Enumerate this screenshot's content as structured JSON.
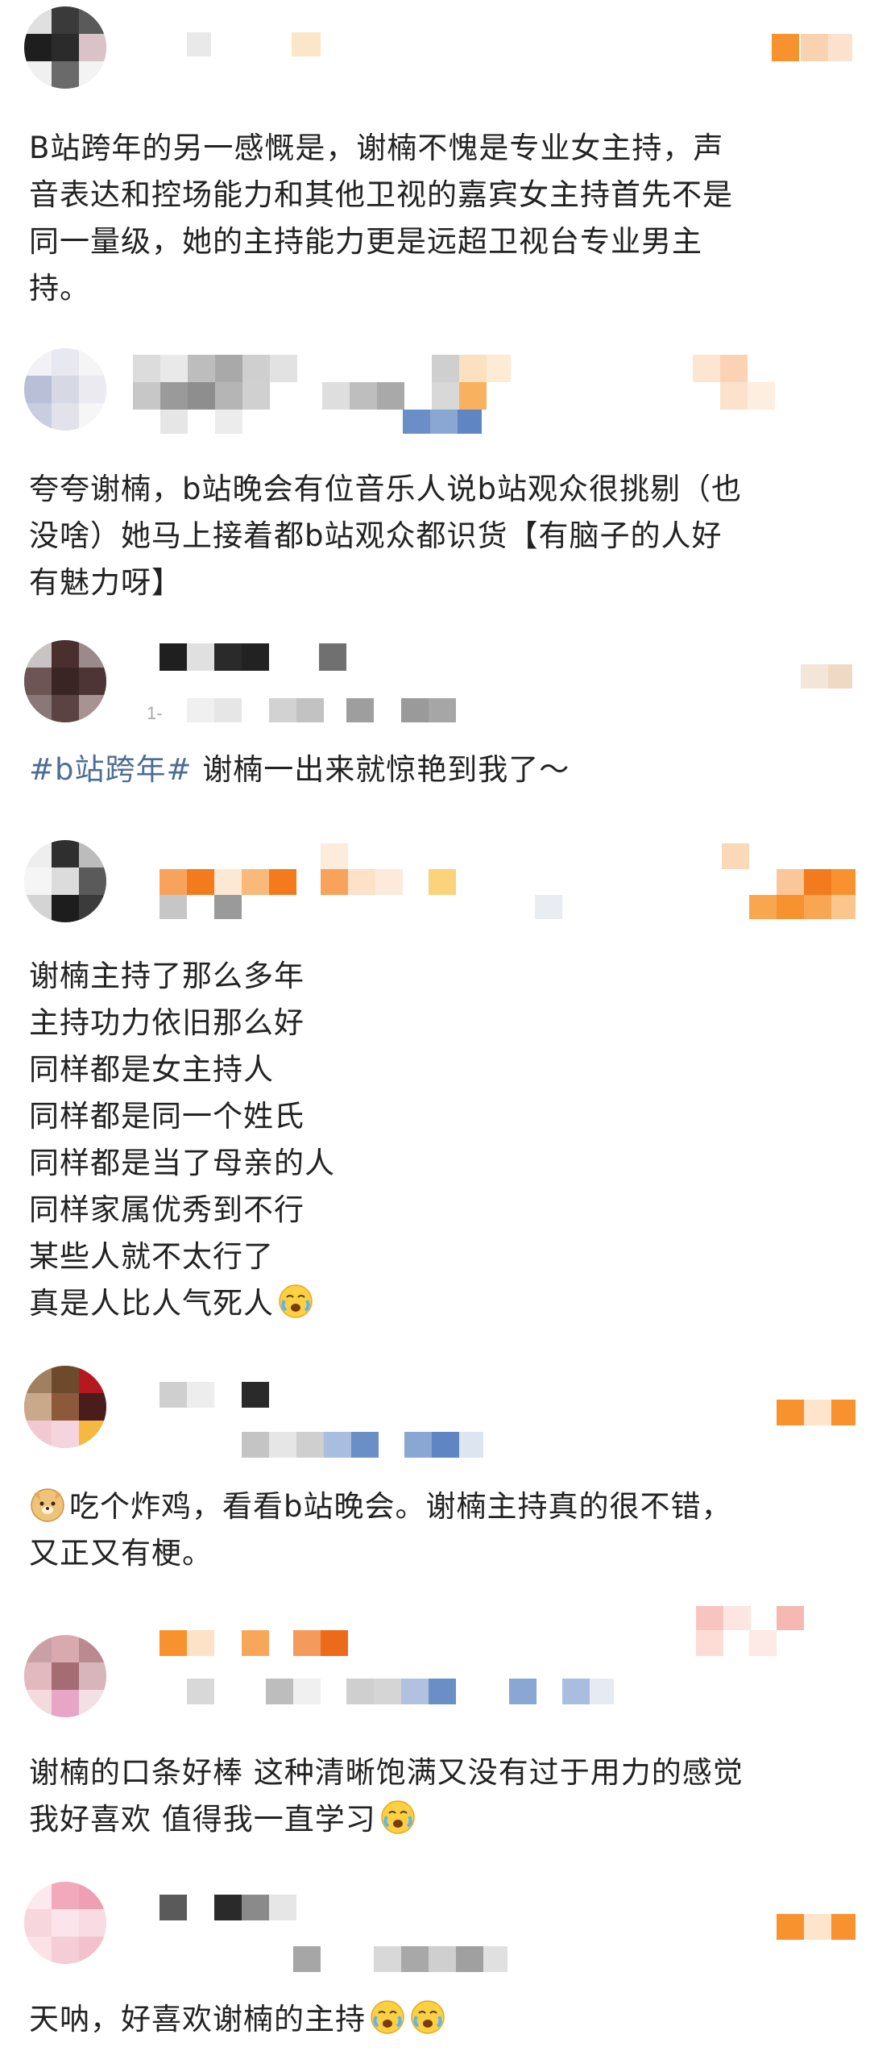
{
  "feed": {
    "posts": [
      {
        "id": "post1",
        "content": [
          "B站跨年的另一感慨是，谢楠不愧是专业女主持，声",
          "音表达和控场能力和其他卫视的嘉宾女主持首先不是",
          "同一量级，她的主持能力更是远超卫视台专业男主",
          "持。"
        ]
      },
      {
        "id": "post2",
        "content": [
          "夸夸谢楠，b站晚会有位音乐人说b站观众很挑剔（也",
          "没啥）她马上接着都b站观众都识货【有脑子的人好",
          "有魅力呀】"
        ]
      },
      {
        "id": "post3",
        "meta_fragment": "1-",
        "hashtag": "#b站跨年#",
        "content_after_hashtag": " 谢楠一出来就惊艳到我了～"
      },
      {
        "id": "post4",
        "content": [
          "谢楠主持了那么多年",
          "主持功力依旧那么好",
          "同样都是女主持人",
          "同样都是同一个姓氏",
          "同样都是当了母亲的人",
          "同样家属优秀到不行",
          "某些人就不太行了",
          "真是人比人气死人"
        ],
        "trailing_emoji": "crying-face-emoji"
      },
      {
        "id": "post5",
        "leading_emoji": "doge-emoji",
        "content": [
          "吃个炸鸡，看看b站晚会。谢楠主持真的很不错，",
          "又正又有梗。"
        ]
      },
      {
        "id": "post6",
        "content": [
          "谢楠的口条好棒 这种清晰饱满又没有过于用力的感觉",
          "我好喜欢 值得我一直学习"
        ],
        "trailing_emoji": "crying-face-emoji"
      },
      {
        "id": "post7",
        "content": [
          "天呐，好喜欢谢楠的主持"
        ],
        "trailing_emojis": [
          "crying-face-emoji",
          "crying-face-emoji"
        ]
      }
    ]
  },
  "colors": {
    "text": "#222222",
    "hashtag": "#4e6d95",
    "orange": "#f7922e",
    "blue": "#6a8fc7",
    "mosaic_gray": "#c8c8c8"
  }
}
